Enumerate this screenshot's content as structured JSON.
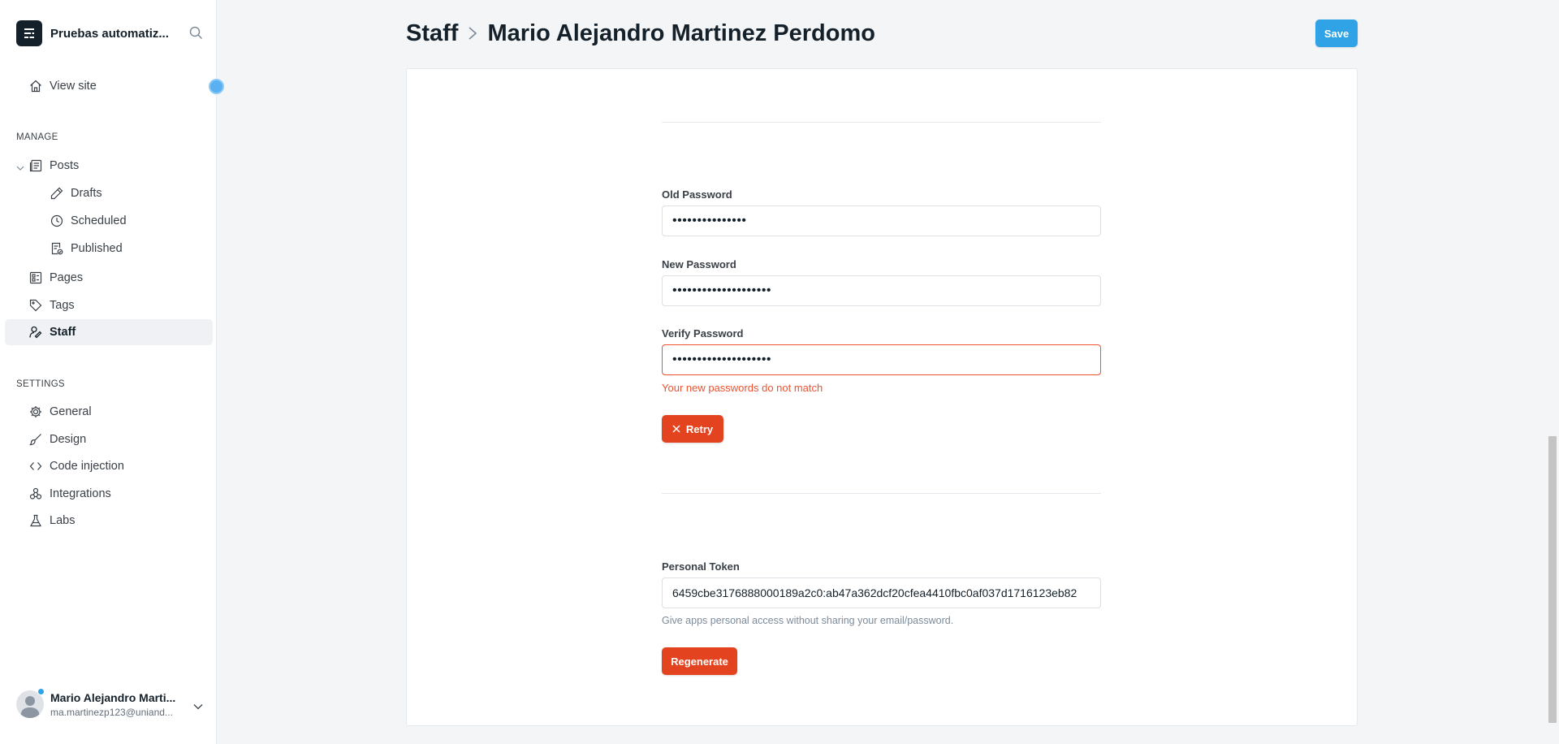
{
  "sidebar": {
    "site_title": "Pruebas automatiz...",
    "view_site": "View site",
    "manage_label": "MANAGE",
    "posts": "Posts",
    "drafts": "Drafts",
    "scheduled": "Scheduled",
    "published": "Published",
    "pages": "Pages",
    "tags": "Tags",
    "staff": "Staff",
    "settings_label": "SETTINGS",
    "general": "General",
    "design": "Design",
    "code_injection": "Code injection",
    "integrations": "Integrations",
    "labs": "Labs",
    "user": {
      "name": "Mario Alejandro Marti...",
      "email": "ma.martinezp123@uniand..."
    }
  },
  "header": {
    "breadcrumb_parent": "Staff",
    "breadcrumb_current": "Mario Alejandro Martinez Perdomo",
    "save_label": "Save"
  },
  "password": {
    "old_label": "Old Password",
    "old_value": "•••••••••••••••",
    "new_label": "New Password",
    "new_value": "••••••••••••••••••••",
    "verify_label": "Verify Password",
    "verify_value": "••••••••••••••••••••",
    "error": "Your new passwords do not match",
    "retry_label": "Retry"
  },
  "token": {
    "label": "Personal Token",
    "value": "6459cbe3176888000189a2c0:ab47a362dcf20cfea4410fbc0af037d1716123eb82",
    "hint": "Give apps personal access without sharing your email/password.",
    "regenerate_label": "Regenerate"
  },
  "colors": {
    "accent_blue": "#30a3e6",
    "danger_red": "#e3441f",
    "error_text": "#f05230"
  }
}
